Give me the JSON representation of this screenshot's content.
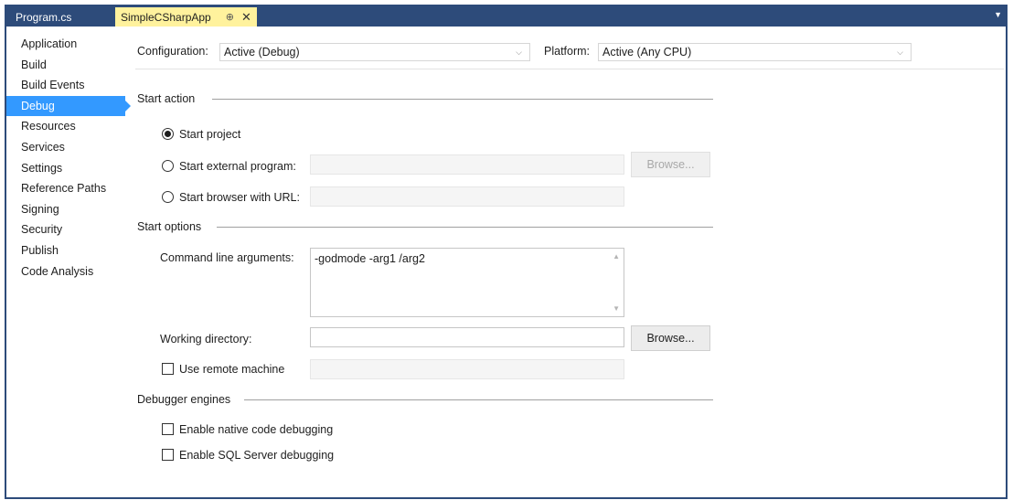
{
  "tabs": [
    {
      "label": "Program.cs",
      "active": false
    },
    {
      "label": "SimpleCSharpApp",
      "active": true
    }
  ],
  "icons": {
    "pin": "pin-icon",
    "close": "close-icon",
    "overflow": "chevron-down-icon"
  },
  "sidebar": {
    "items": [
      {
        "label": "Application"
      },
      {
        "label": "Build"
      },
      {
        "label": "Build Events"
      },
      {
        "label": "Debug",
        "selected": true
      },
      {
        "label": "Resources"
      },
      {
        "label": "Services"
      },
      {
        "label": "Settings"
      },
      {
        "label": "Reference Paths"
      },
      {
        "label": "Signing"
      },
      {
        "label": "Security"
      },
      {
        "label": "Publish"
      },
      {
        "label": "Code Analysis"
      }
    ]
  },
  "config": {
    "configuration_label": "Configuration:",
    "configuration_value": "Active (Debug)",
    "platform_label": "Platform:",
    "platform_value": "Active (Any CPU)"
  },
  "start_action": {
    "title": "Start action",
    "start_project": "Start project",
    "start_external": "Start external program:",
    "start_browser": "Start browser with URL:",
    "browse_label": "Browse..."
  },
  "start_options": {
    "title": "Start options",
    "cmd_label": "Command line arguments:",
    "cmd_value": "-godmode -arg1 /arg2",
    "workdir_label": "Working directory:",
    "workdir_value": "",
    "browse_label": "Browse...",
    "remote_label": "Use remote machine"
  },
  "debugger_engines": {
    "title": "Debugger engines",
    "native_label": "Enable native code debugging",
    "sql_label": "Enable SQL Server debugging"
  },
  "colors": {
    "frame": "#2d4b7a",
    "active_tab": "#fff29d",
    "selection": "#3399ff"
  }
}
